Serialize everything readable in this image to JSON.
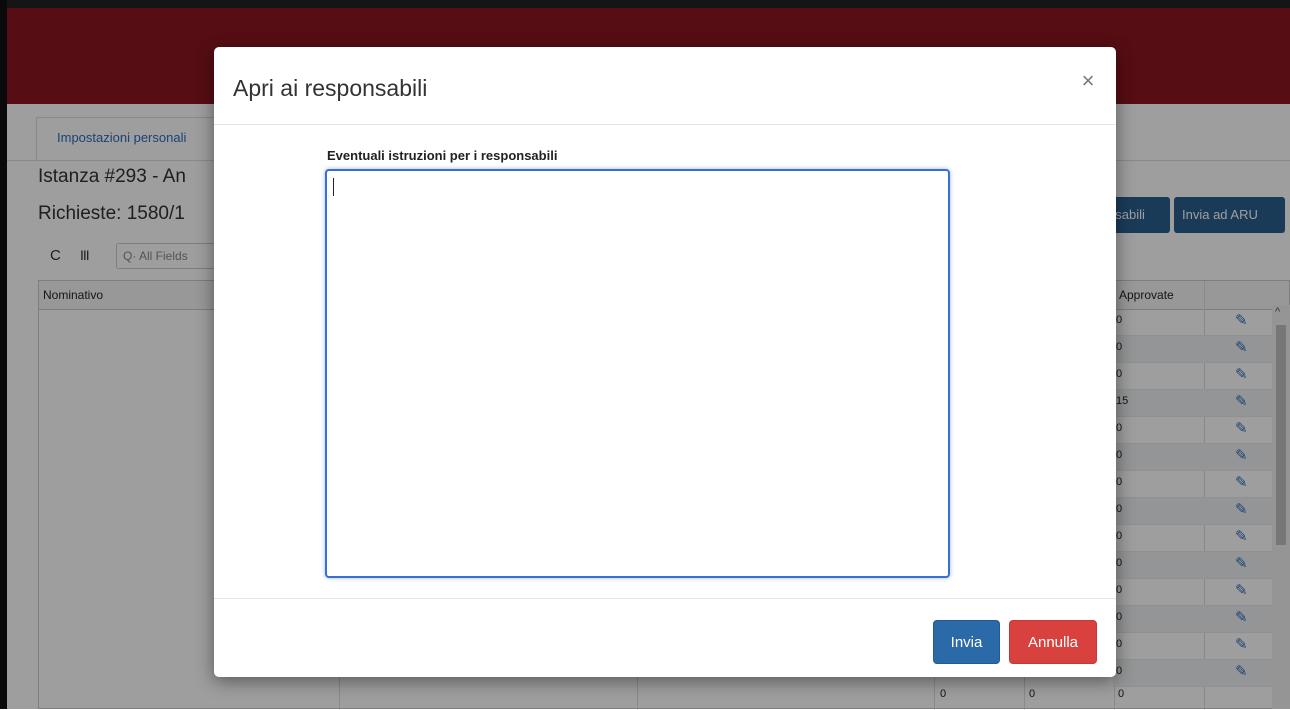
{
  "background": {
    "header_color": "#8b1520",
    "tab_label": "Impostazioni personali",
    "title": "Istanza #293 - An",
    "requests": "Richieste: 1580/1",
    "toolbar": {
      "search_placeholder": "All Fields"
    },
    "buttons": [
      "nsabili",
      "Invia ad ARU"
    ],
    "grid": {
      "col_nominativo": "Nominativo",
      "col_approvate": "Approvate",
      "approvate_values": [
        "0",
        "0",
        "0",
        "15",
        "0",
        "0",
        "0",
        "0",
        "0",
        "0",
        "0",
        "0",
        "0",
        "0"
      ],
      "bottom_row": [
        "0",
        "0",
        "0"
      ]
    }
  },
  "modal": {
    "title": "Apri ai responsabili",
    "close_symbol": "×",
    "field_label": "Eventuali istruzioni per i responsabili",
    "textarea_value": "",
    "submit_label": "Invia",
    "cancel_label": "Annulla",
    "colors": {
      "submit": "#2b6aa8",
      "cancel": "#d9413e",
      "focus": "#3a6fd0"
    }
  }
}
